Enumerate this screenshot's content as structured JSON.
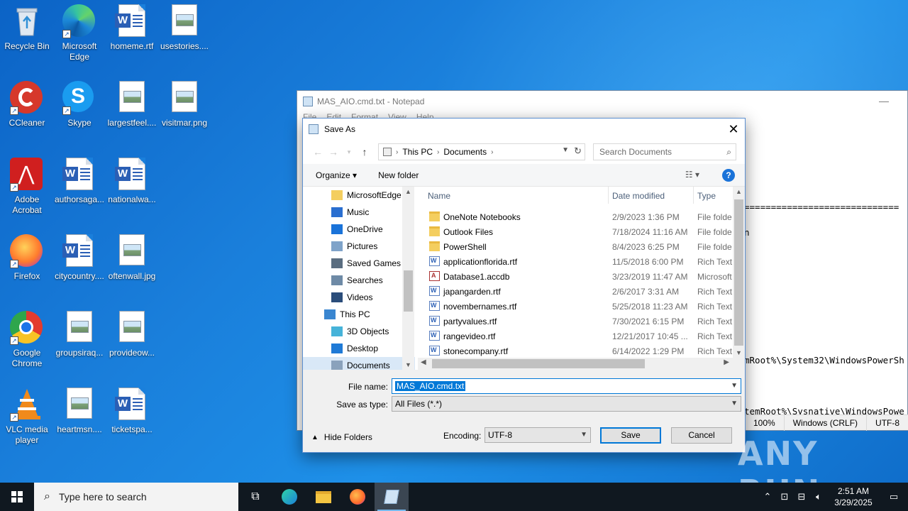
{
  "desktop": {
    "icons": [
      {
        "label": "Recycle Bin",
        "icon": "recycle-bin-icon"
      },
      {
        "label": "Microsoft Edge",
        "icon": "edge-icon"
      },
      {
        "label": "homeme.rtf",
        "icon": "word-doc-icon"
      },
      {
        "label": "usestories....",
        "icon": "image-file-icon"
      },
      {
        "label": "CCleaner",
        "icon": "ccleaner-icon"
      },
      {
        "label": "Skype",
        "icon": "skype-icon"
      },
      {
        "label": "largestfeel....",
        "icon": "image-file-icon"
      },
      {
        "label": "visitmar.png",
        "icon": "image-file-icon"
      },
      {
        "label": "Adobe Acrobat",
        "icon": "acrobat-icon"
      },
      {
        "label": "authorsaga...",
        "icon": "word-doc-icon"
      },
      {
        "label": "nationalwa...",
        "icon": "word-doc-icon"
      },
      {
        "label": "Firefox",
        "icon": "firefox-icon"
      },
      {
        "label": "citycountry....",
        "icon": "word-doc-icon"
      },
      {
        "label": "oftenwall.jpg",
        "icon": "image-file-icon"
      },
      {
        "label": "Google Chrome",
        "icon": "chrome-icon"
      },
      {
        "label": "groupsiraq...",
        "icon": "image-file-icon"
      },
      {
        "label": "provideow...",
        "icon": "image-file-icon"
      },
      {
        "label": "VLC media player",
        "icon": "vlc-icon"
      },
      {
        "label": "heartmsn....",
        "icon": "image-file-icon"
      },
      {
        "label": "ticketspa...",
        "icon": "word-doc-icon"
      }
    ]
  },
  "notepad": {
    "title": "MAS_AIO.cmd.txt - Notepad",
    "menu": [
      "File",
      "Edit",
      "Format",
      "View",
      "Help"
    ],
    "text_lines": [
      "",
      "",
      "",
      "",
      "",
      "",
      "=============================",
      "",
      "n",
      "",
      "",
      "",
      "",
      "",
      "",
      "",
      "",
      "",
      "mRoot%\\System32\\WindowsPowerSh",
      "",
      "",
      "",
      "temRoot%\\Sysnative\\WindowsPowe"
    ],
    "status": {
      "zoom": "100%",
      "eol": "Windows (CRLF)",
      "encoding": "UTF-8"
    }
  },
  "dialog": {
    "title": "Save As",
    "close_glyph": "✕",
    "address": {
      "segments": [
        "This PC",
        "Documents"
      ]
    },
    "search_placeholder": "Search Documents",
    "toolbar": {
      "organize": "Organize ▾",
      "new_folder": "New folder",
      "help": "?"
    },
    "tree": [
      {
        "label": "MicrosoftEdge",
        "icon": "folder-icon",
        "indent": 2
      },
      {
        "label": "Music",
        "icon": "music-icon",
        "indent": 2
      },
      {
        "label": "OneDrive",
        "icon": "onedrive-icon",
        "indent": 2
      },
      {
        "label": "Pictures",
        "icon": "pictures-icon",
        "indent": 2
      },
      {
        "label": "Saved Games",
        "icon": "saved-games-icon",
        "indent": 2
      },
      {
        "label": "Searches",
        "icon": "search-folder-icon",
        "indent": 2
      },
      {
        "label": "Videos",
        "icon": "videos-icon",
        "indent": 2
      },
      {
        "label": "This PC",
        "icon": "this-pc-icon",
        "indent": 1
      },
      {
        "label": "3D Objects",
        "icon": "3d-objects-icon",
        "indent": 2
      },
      {
        "label": "Desktop",
        "icon": "desktop-folder-icon",
        "indent": 2
      },
      {
        "label": "Documents",
        "icon": "documents-icon",
        "indent": 2,
        "selected": true
      }
    ],
    "columns": {
      "name": "Name",
      "date": "Date modified",
      "type": "Type"
    },
    "files": [
      {
        "name": "OneNote Notebooks",
        "date": "2/9/2023 1:36 PM",
        "type": "File folde",
        "kind": "folder"
      },
      {
        "name": "Outlook Files",
        "date": "7/18/2024 11:16 AM",
        "type": "File folde",
        "kind": "folder"
      },
      {
        "name": "PowerShell",
        "date": "8/4/2023 6:25 PM",
        "type": "File folde",
        "kind": "folder"
      },
      {
        "name": "applicationflorida.rtf",
        "date": "11/5/2018 6:00 PM",
        "type": "Rich Text",
        "kind": "rtf"
      },
      {
        "name": "Database1.accdb",
        "date": "3/23/2019 11:47 AM",
        "type": "Microsoft",
        "kind": "accdb"
      },
      {
        "name": "japangarden.rtf",
        "date": "2/6/2017 3:31 AM",
        "type": "Rich Text",
        "kind": "rtf"
      },
      {
        "name": "novembernames.rtf",
        "date": "5/25/2018 11:23 AM",
        "type": "Rich Text",
        "kind": "rtf"
      },
      {
        "name": "partyvalues.rtf",
        "date": "7/30/2021 6:15 PM",
        "type": "Rich Text",
        "kind": "rtf"
      },
      {
        "name": "rangevideo.rtf",
        "date": "12/21/2017 10:45 ...",
        "type": "Rich Text",
        "kind": "rtf"
      },
      {
        "name": "stonecompany.rtf",
        "date": "6/14/2022 1:29 PM",
        "type": "Rich Text",
        "kind": "rtf"
      }
    ],
    "file_name_label": "File name:",
    "file_name_value": "MAS_AIO.cmd.txt",
    "save_type_label": "Save as type:",
    "save_type_value": "All Files  (*.*)",
    "hide_folders": "Hide Folders",
    "encoding_label": "Encoding:",
    "encoding_value": "UTF-8",
    "save_button": "Save",
    "cancel_button": "Cancel"
  },
  "taskbar": {
    "search_placeholder": "Type here to search",
    "time": "2:51 AM",
    "date": "3/29/2025"
  },
  "watermark": "ANY RUN",
  "colors": {
    "accent": "#0078d7",
    "desktop": "#1a7fdb",
    "taskbar": "#101820"
  }
}
